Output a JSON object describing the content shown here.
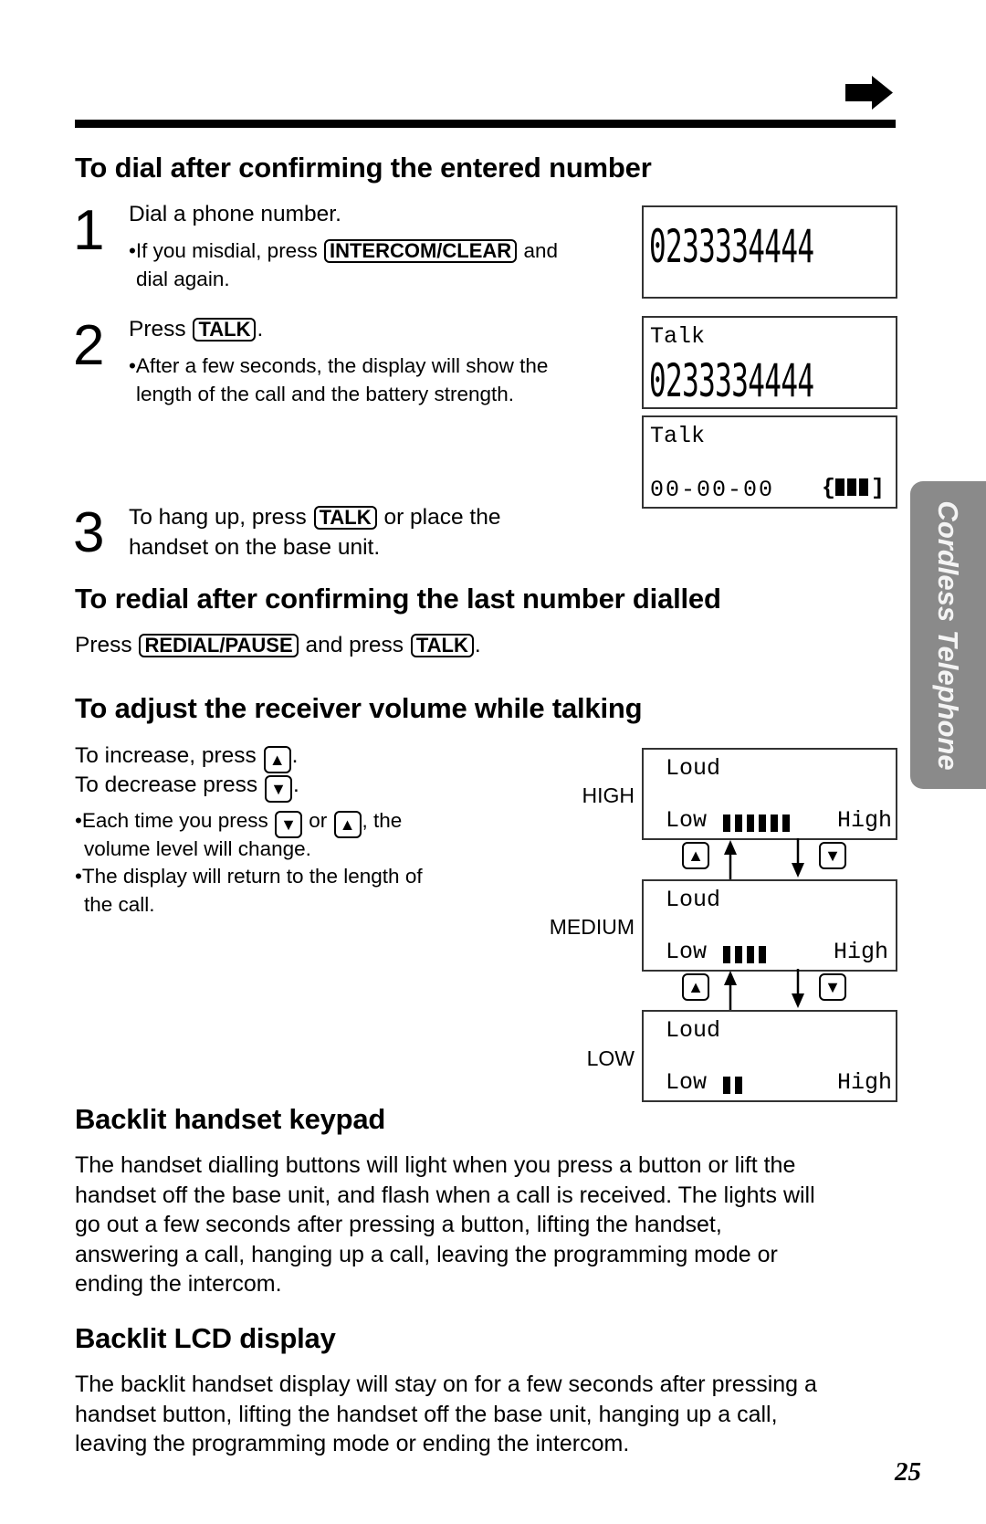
{
  "page": {
    "number": "25",
    "side_tab": "Cordless Telephone"
  },
  "section_dial": {
    "title": "To dial after confirming the entered number",
    "steps": [
      {
        "number": "1",
        "main": "Dial a phone number.",
        "note_pre": "•If you misdial, press",
        "note_key": "INTERCOM/CLEAR",
        "note_post": "and",
        "note_line2": "dial again."
      },
      {
        "number": "2",
        "main_pre": "Press",
        "main_key": "TALK",
        "main_post": ".",
        "note_line1": "•After a few seconds, the display will show the",
        "note_line2": "length of the call and the battery strength."
      },
      {
        "number": "3",
        "line1_pre": "To hang up, press",
        "line1_key": "TALK",
        "line1_post": "or place the",
        "line2": "handset on the base unit."
      }
    ],
    "displays": [
      {
        "line1": "",
        "number": "0233334444"
      },
      {
        "line1": "Talk",
        "number": "0233334444"
      },
      {
        "line1": "Talk",
        "timer": "00-00-00",
        "battery_open": "{",
        "battery_close": "]",
        "battery_level": 3,
        "battery_max": 3
      }
    ]
  },
  "section_redial": {
    "title": "To redial after confirming the last number dialled",
    "pre": "Press",
    "key1": "REDIAL/PAUSE",
    "mid": "and press",
    "key2": "TALK",
    "post": "."
  },
  "section_volume": {
    "title": "To adjust the receiver volume while talking",
    "increase_pre": "To increase, press",
    "increase_key": "▲",
    "increase_post": ".",
    "decrease_pre": "To decrease press",
    "decrease_key": "▼",
    "decrease_post": ".",
    "note1_pre": "•Each time you press",
    "note1_key1": "▼",
    "note1_mid": "or",
    "note1_key2": "▲",
    "note1_post": ", the",
    "note1_line2": "volume level will change.",
    "note2_line1": "•The display will return to the length of",
    "note2_line2": "the call.",
    "levels": [
      {
        "label": "HIGH",
        "loud": "Loud",
        "low": "Low",
        "high": "High",
        "bars": 6
      },
      {
        "label": "MEDIUM",
        "loud": "Loud",
        "low": "Low",
        "high": "High",
        "bars": 4
      },
      {
        "label": "LOW",
        "loud": "Loud",
        "low": "Low",
        "high": "High",
        "bars": 2
      }
    ],
    "up_key": "▲",
    "down_key": "▼"
  },
  "section_keypad": {
    "title": "Backlit handset keypad",
    "lines": [
      "The handset dialling buttons will light when you press a button or lift the",
      "handset off the base unit, and flash when a call is received. The lights will",
      "go out a few seconds after pressing a button, lifting the handset,",
      "answering a call, hanging up a call, leaving the programming mode or",
      "ending the intercom."
    ]
  },
  "section_lcd": {
    "title": "Backlit LCD display",
    "lines": [
      "The backlit handset display will stay on for a few seconds after pressing a",
      "handset button, lifting the handset off the base unit, hanging up a call,",
      "leaving the programming mode or ending the intercom."
    ]
  }
}
